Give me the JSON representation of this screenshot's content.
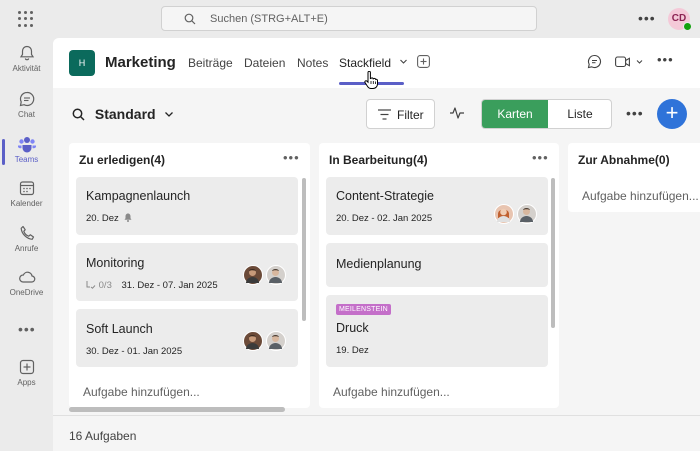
{
  "search": {
    "placeholder": "Suchen (STRG+ALT+E)"
  },
  "user": {
    "initials": "CD",
    "status_color": "#13a10e"
  },
  "rail": {
    "items": [
      {
        "label": "Aktivität",
        "icon": "bell-icon"
      },
      {
        "label": "Chat",
        "icon": "chat-icon"
      },
      {
        "label": "Teams",
        "icon": "teams-icon",
        "active": true
      },
      {
        "label": "Kalender",
        "icon": "calendar-icon"
      },
      {
        "label": "Anrufe",
        "icon": "phone-icon"
      },
      {
        "label": "OneDrive",
        "icon": "cloud-icon"
      },
      {
        "label": "Apps",
        "icon": "apps-plus-icon"
      }
    ]
  },
  "channel": {
    "team_initial": "H",
    "team_name": "Marketing",
    "tabs": [
      "Beiträge",
      "Dateien",
      "Notes",
      "Stackfield"
    ],
    "active_tab": "Stackfield"
  },
  "toolbar": {
    "view": "Standard",
    "filter_label": "Filter",
    "toggle_on": "Karten",
    "toggle_off": "Liste"
  },
  "columns": [
    {
      "title": "Zu erledigen(4)",
      "cards": [
        {
          "title": "Kampagnenlaunch",
          "meta": "20. Dez",
          "bell": true
        },
        {
          "title": "Monitoring",
          "checklist": "0/3",
          "meta": "31. Dez - 07. Jan 2025"
        },
        {
          "title": "Soft Launch",
          "meta": "30. Dez - 01. Jan 2025"
        }
      ],
      "add_label": "Aufgabe hinzufügen..."
    },
    {
      "title": "In Bearbeitung(4)",
      "cards": [
        {
          "title": "Content-Strategie",
          "meta": "20. Dez - 02. Jan 2025"
        },
        {
          "title": "Medienplanung"
        },
        {
          "badge": "MEILENSTEIN",
          "title": "Druck",
          "meta": "19. Dez"
        }
      ],
      "add_label": "Aufgabe hinzufügen..."
    },
    {
      "title": "Zur Abnahme(0)",
      "add_label": "Aufgabe hinzufügen..."
    }
  ],
  "footer": {
    "count_label": "16 Aufgaben"
  },
  "colors": {
    "accent": "#5b5fc7",
    "toggle_green": "#3a9e5c",
    "fab_blue": "#2f73d9",
    "team_icon": "#0b6a5c",
    "milestone": "#c46fc9"
  }
}
